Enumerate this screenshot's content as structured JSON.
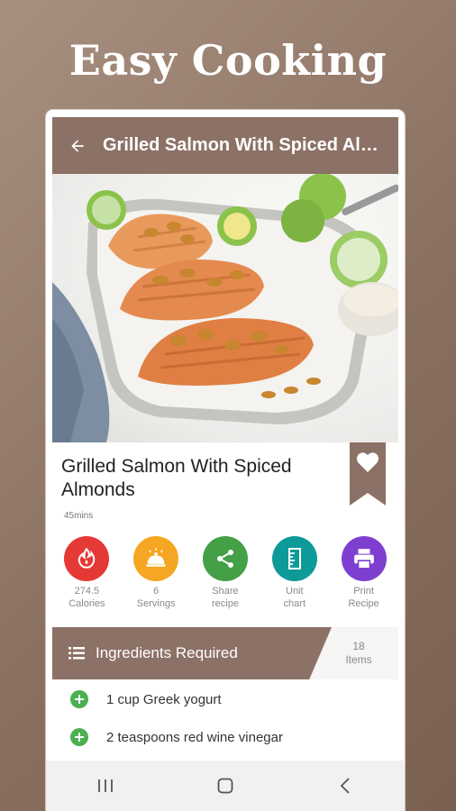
{
  "headline": "Easy Cooking",
  "toolbar": {
    "title": "Grilled Salmon With Spiced Almonds",
    "back_icon": "arrow-back-icon"
  },
  "recipe": {
    "title": "Grilled Salmon With Spiced Almonds",
    "duration": "45mins",
    "favorite_icon": "heart-icon"
  },
  "actions": [
    {
      "line1": "274.5",
      "line2": "Calories",
      "color": "#e53935",
      "icon": "flame-icon"
    },
    {
      "line1": "6",
      "line2": "Servings",
      "color": "#f5a623",
      "icon": "serving-dish-icon"
    },
    {
      "line1": "Share",
      "line2": "recipe",
      "color": "#43a047",
      "icon": "share-icon"
    },
    {
      "line1": "Unit",
      "line2": "chart",
      "color": "#0f9a9a",
      "icon": "ruler-icon"
    },
    {
      "line1": "Print",
      "line2": "Recipe",
      "color": "#7e3fd1",
      "icon": "printer-icon"
    }
  ],
  "ingredients": {
    "header": "Ingredients Required",
    "count_value": "18",
    "count_label": "Items",
    "items": [
      "1 cup Greek yogurt",
      "2 teaspoons red wine vinegar"
    ]
  },
  "colors": {
    "brand": "#8c7166",
    "accent_green": "#4caf50"
  },
  "navbar": {
    "icons": [
      "recents-icon",
      "home-icon",
      "back-icon"
    ]
  }
}
